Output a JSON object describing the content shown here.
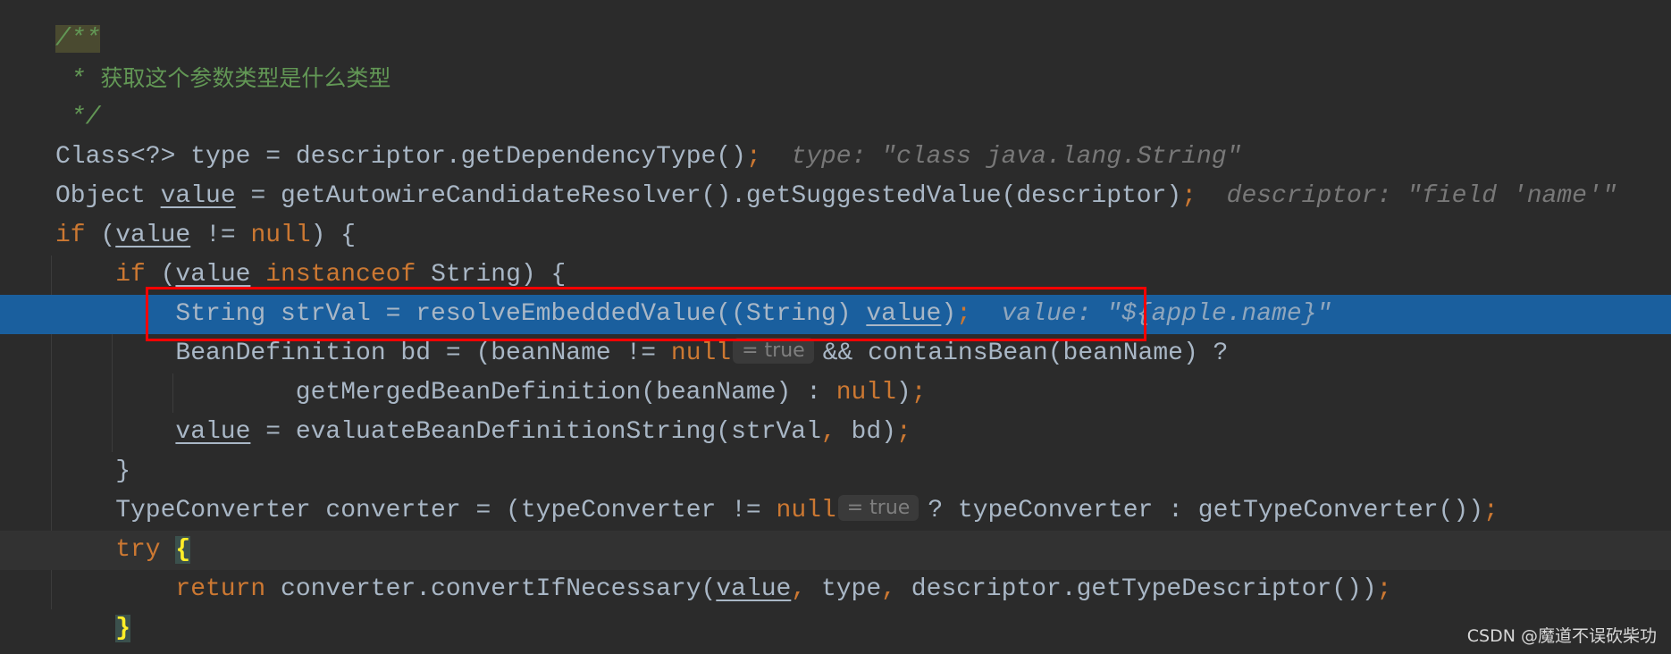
{
  "colors": {
    "background": "#2b2b2b",
    "text": "#a9b7c6",
    "keyword": "#cc7832",
    "comment": "#629755",
    "hint": "#787878",
    "selection": "#1a5f9e",
    "annotation_box": "#ff0000"
  },
  "editor": {
    "selected_line": 7,
    "caret_line": 13,
    "lines": [
      {
        "indent": 0,
        "tokens": [
          {
            "t": "/**",
            "c": "cm cmbg"
          }
        ]
      },
      {
        "indent": 0,
        "tokens": [
          {
            "t": " * ",
            "c": "cm"
          },
          {
            "t": "获取这个参数类型是什么类型",
            "c": "cm cjk"
          }
        ]
      },
      {
        "indent": 0,
        "tokens": [
          {
            "t": " */",
            "c": "cm"
          }
        ]
      },
      {
        "indent": 0,
        "tokens": [
          {
            "t": "Class<?> type = descriptor.getDependencyType()",
            "c": ""
          },
          {
            "t": ";",
            "c": "kw"
          },
          {
            "t": "  type: \"class java.lang.String\"",
            "c": "hint"
          }
        ]
      },
      {
        "indent": 0,
        "tokens": [
          {
            "t": "Object ",
            "c": ""
          },
          {
            "t": "value",
            "c": "ul"
          },
          {
            "t": " = getAutowireCandidateResolver().getSuggestedValue(descriptor)",
            "c": ""
          },
          {
            "t": ";",
            "c": "kw"
          },
          {
            "t": "  descriptor: \"field 'name'\"",
            "c": "hint"
          }
        ]
      },
      {
        "indent": 0,
        "tokens": [
          {
            "t": "if",
            "c": "kw"
          },
          {
            "t": " (",
            "c": ""
          },
          {
            "t": "value",
            "c": "ul"
          },
          {
            "t": " != ",
            "c": ""
          },
          {
            "t": "null",
            "c": "kw"
          },
          {
            "t": ") {",
            "c": ""
          }
        ]
      },
      {
        "indent": 1,
        "tokens": [
          {
            "t": "if",
            "c": "kw"
          },
          {
            "t": " (",
            "c": ""
          },
          {
            "t": "value",
            "c": "ul"
          },
          {
            "t": " ",
            "c": ""
          },
          {
            "t": "instanceof",
            "c": "kw"
          },
          {
            "t": " String) {",
            "c": ""
          }
        ]
      },
      {
        "indent": 2,
        "tokens": [
          {
            "t": "String strVal = resolveEmbeddedValue((String) ",
            "c": ""
          },
          {
            "t": "value",
            "c": "ul"
          },
          {
            "t": ")",
            "c": ""
          },
          {
            "t": ";",
            "c": "kw"
          },
          {
            "t": "  value: \"${apple.name}\"",
            "c": "hint onsel"
          }
        ]
      },
      {
        "indent": 2,
        "tokens": [
          {
            "t": "BeanDefinition bd = (beanName != ",
            "c": ""
          },
          {
            "t": "null",
            "c": "kw"
          },
          {
            "t": "= true",
            "c": "inlay"
          },
          {
            "t": "&& containsBean(beanName) ?",
            "c": ""
          }
        ]
      },
      {
        "indent": 4,
        "tokens": [
          {
            "t": "getMergedBeanDefinition(beanName) : ",
            "c": ""
          },
          {
            "t": "null",
            "c": "kw"
          },
          {
            "t": ")",
            "c": ""
          },
          {
            "t": ";",
            "c": "kw"
          }
        ]
      },
      {
        "indent": 2,
        "tokens": [
          {
            "t": "value",
            "c": "ul"
          },
          {
            "t": " = evaluateBeanDefinitionString(strVal",
            "c": ""
          },
          {
            "t": ",",
            "c": "kw"
          },
          {
            "t": " bd)",
            "c": ""
          },
          {
            "t": ";",
            "c": "kw"
          }
        ]
      },
      {
        "indent": 1,
        "tokens": [
          {
            "t": "}",
            "c": ""
          }
        ]
      },
      {
        "indent": 1,
        "tokens": [
          {
            "t": "TypeConverter converter = (typeConverter != ",
            "c": ""
          },
          {
            "t": "null",
            "c": "kw"
          },
          {
            "t": "= true",
            "c": "inlay"
          },
          {
            "t": "? typeConverter : getTypeConverter())",
            "c": ""
          },
          {
            "t": ";",
            "c": "kw"
          }
        ]
      },
      {
        "indent": 1,
        "tokens": [
          {
            "t": "try",
            "c": "kw"
          },
          {
            "t": " ",
            "c": ""
          },
          {
            "t": "{",
            "c": "brace"
          }
        ]
      },
      {
        "indent": 2,
        "tokens": [
          {
            "t": "return",
            "c": "kw"
          },
          {
            "t": " converter.convertIfNecessary(",
            "c": ""
          },
          {
            "t": "value",
            "c": "ul"
          },
          {
            "t": ",",
            "c": "kw"
          },
          {
            "t": " type",
            "c": ""
          },
          {
            "t": ",",
            "c": "kw"
          },
          {
            "t": " descriptor.getTypeDescriptor())",
            "c": ""
          },
          {
            "t": ";",
            "c": "kw"
          }
        ]
      },
      {
        "indent": 1,
        "tokens": [
          {
            "t": "}",
            "c": "brace"
          }
        ]
      }
    ]
  },
  "watermark": "CSDN @魔道不误砍柴功"
}
